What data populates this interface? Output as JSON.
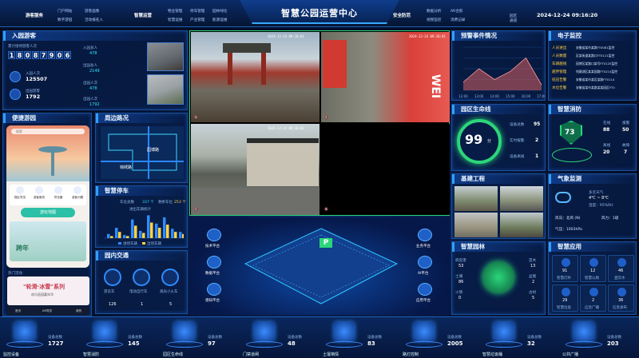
{
  "header": {
    "title": "智慧公园运营中心",
    "datetime": "2024-12-24 09:16:20",
    "left_main": "游客服务",
    "left_main2": "智慧运营",
    "right_main": "安全防范",
    "nav_left1": [
      [
        "门户网站",
        "游客画像"
      ],
      [
        "数字游园",
        "活动报名入"
      ]
    ],
    "nav_left2": [
      [
        "物业管理",
        "停车管理",
        "园林绿化"
      ],
      [
        "智慧运维",
        "产业管理",
        "能源运维"
      ]
    ],
    "nav_right": [
      [
        "数据分析",
        "AR合影"
      ],
      [
        "视频监控",
        "消费记录"
      ]
    ],
    "nav_right2": [
      "园区",
      "通道"
    ]
  },
  "visitors": {
    "title": "入园游客",
    "label_today": "累计接待游客人次",
    "digits": [
      "1",
      "8",
      "0",
      "8",
      "7",
      "9",
      "0",
      "6"
    ],
    "in_label": "入园人次",
    "in_value": "125507",
    "out_label": "出园游客",
    "out_value": "1792",
    "side": [
      {
        "label": "入园总人",
        "v": "478"
      },
      {
        "label": "出园总人",
        "v": "2149"
      },
      {
        "label": "出园人次",
        "v": "478"
      },
      {
        "label": "出园人次",
        "v": "1792"
      }
    ]
  },
  "convenience": {
    "title": "便捷游园",
    "search_placeholder": "搜索",
    "icons": [
      "园区导览",
      "游客服务",
      "导览器",
      "游客问题"
    ],
    "map_button": "游玩地图",
    "banner": "跨年",
    "bottom": [
      "首页",
      "AR导览",
      "我的"
    ],
    "section": "热门活动",
    "activity_title": "\"轮滑·冰雪\"系列",
    "activity_sub": "欢乐逛园嘉年华"
  },
  "surrounding": {
    "title": "周边路况",
    "roads": [
      "园博路",
      "锦绣路"
    ]
  },
  "parking": {
    "title": "智慧停车",
    "stat1_label": "车位总数",
    "stat1": "337 个",
    "stat2_label": "剩余车位",
    "stat2": "253 个",
    "subtitle": "进出车辆统计",
    "legend": [
      "进场车辆",
      "出场车辆"
    ]
  },
  "traffic": {
    "title": "园内交通",
    "items": [
      {
        "label": "游览车",
        "count": "126"
      },
      {
        "label": "电动自行车",
        "count": "1"
      },
      {
        "label": "观光小火车",
        "count": "5"
      }
    ]
  },
  "cameras": [
    {
      "ts": "2024-12-24 09:16:01",
      "icon": "mute"
    },
    {
      "ts": "2024-12-24 09:16:01",
      "icon": "mute"
    },
    {
      "ts": "2024-12-24 09:16:02",
      "icon": "mute"
    },
    {
      "ts": "",
      "icon": "mute"
    }
  ],
  "center": {
    "left_icons": [
      "技术平台",
      "数据平台",
      "感知平台"
    ],
    "right_icons": [
      "业务平台",
      "AI平台",
      "应用平台"
    ],
    "parking_sign": "P"
  },
  "alarm": {
    "title": "预警事件情况",
    "chart_data": {
      "type": "area",
      "x": [
        "12:00",
        "13:00",
        "14:00",
        "15:00",
        "16:00",
        "17:00"
      ],
      "values": [
        3,
        8,
        4,
        7,
        12,
        2
      ],
      "ylim": [
        0,
        16
      ]
    }
  },
  "fence": {
    "title": "电子监控",
    "rows": [
      {
        "name": "人员进出",
        "text": "安徽省某市某路FT0081监控"
      },
      {
        "name": "人员数量",
        "text": "区某街道某路口FT0121监控"
      },
      {
        "name": "车辆越线",
        "text": "园博区某路口某号FT0125监控"
      },
      {
        "name": "越界管理",
        "text": "钱塘湖区某某园路FT0214监控"
      },
      {
        "name": "低压告警",
        "text": "安徽省某市某区某路FT0114"
      },
      {
        "name": "水位告警",
        "text": "安徽省某市某路某某园区FT0"
      }
    ]
  },
  "life": {
    "title": "园区生命线",
    "score": "99",
    "score_unit": "分",
    "items": [
      {
        "label": "设备总数",
        "v": "95"
      },
      {
        "label": "实时报警",
        "v": "2"
      },
      {
        "label": "设备离线",
        "v": "1"
      }
    ]
  },
  "fire": {
    "title": "智慧消防",
    "score": "73",
    "stats": [
      {
        "label": "在线",
        "v": "88"
      },
      {
        "label": "报警",
        "v": "50"
      },
      {
        "label": "离线",
        "v": "20"
      },
      {
        "label": "故障",
        "v": "7"
      }
    ]
  },
  "project": {
    "title": "基建工程"
  },
  "weather": {
    "title": "气象监测",
    "weather": "多云天气",
    "temp": "4℃ ~ 8℃",
    "humidity": "湿度：95%RH",
    "wind_dir": "风向：北风 (N)",
    "wind_level": "风力：1级",
    "pressure": "气压：1003hPa"
  },
  "garden": {
    "title": "智慧园林",
    "left": [
      {
        "label": "病虫害",
        "v": "53"
      },
      {
        "label": "土壤",
        "v": "86"
      },
      {
        "label": "火情",
        "v": "0"
      }
    ],
    "right": [
      {
        "label": "苗木",
        "v": "13"
      },
      {
        "label": "盆栽",
        "v": "2"
      },
      {
        "label": "古树",
        "v": "5"
      }
    ]
  },
  "apps": {
    "title": "智慧应用",
    "items": [
      {
        "label": "智慧灯杆",
        "v": "91"
      },
      {
        "label": "智慧公厕",
        "v": "12"
      },
      {
        "label": "直饮水",
        "v": "46"
      },
      {
        "label": "智慧垃圾",
        "v": "29"
      },
      {
        "label": "应急广播",
        "v": "2"
      },
      {
        "label": "信息发布",
        "v": "36"
      }
    ]
  },
  "bottom": [
    {
      "label": "监控设备",
      "count_label": "设备总数",
      "count": "1727"
    },
    {
      "label": "智慧消防",
      "count_label": "设备总数",
      "count": "145"
    },
    {
      "label": "园区生命线",
      "count_label": "设备总数",
      "count": "97"
    },
    {
      "label": "门禁道闸",
      "count_label": "设备总数",
      "count": "48"
    },
    {
      "label": "土壤墒情",
      "count_label": "设备总数",
      "count": "83"
    },
    {
      "label": "路灯控制",
      "count_label": "设备总数",
      "count": "2005"
    },
    {
      "label": "智慧垃圾桶",
      "count_label": "设备总数",
      "count": "32"
    },
    {
      "label": "公共广播",
      "count_label": "设备总数",
      "count": "203"
    }
  ]
}
